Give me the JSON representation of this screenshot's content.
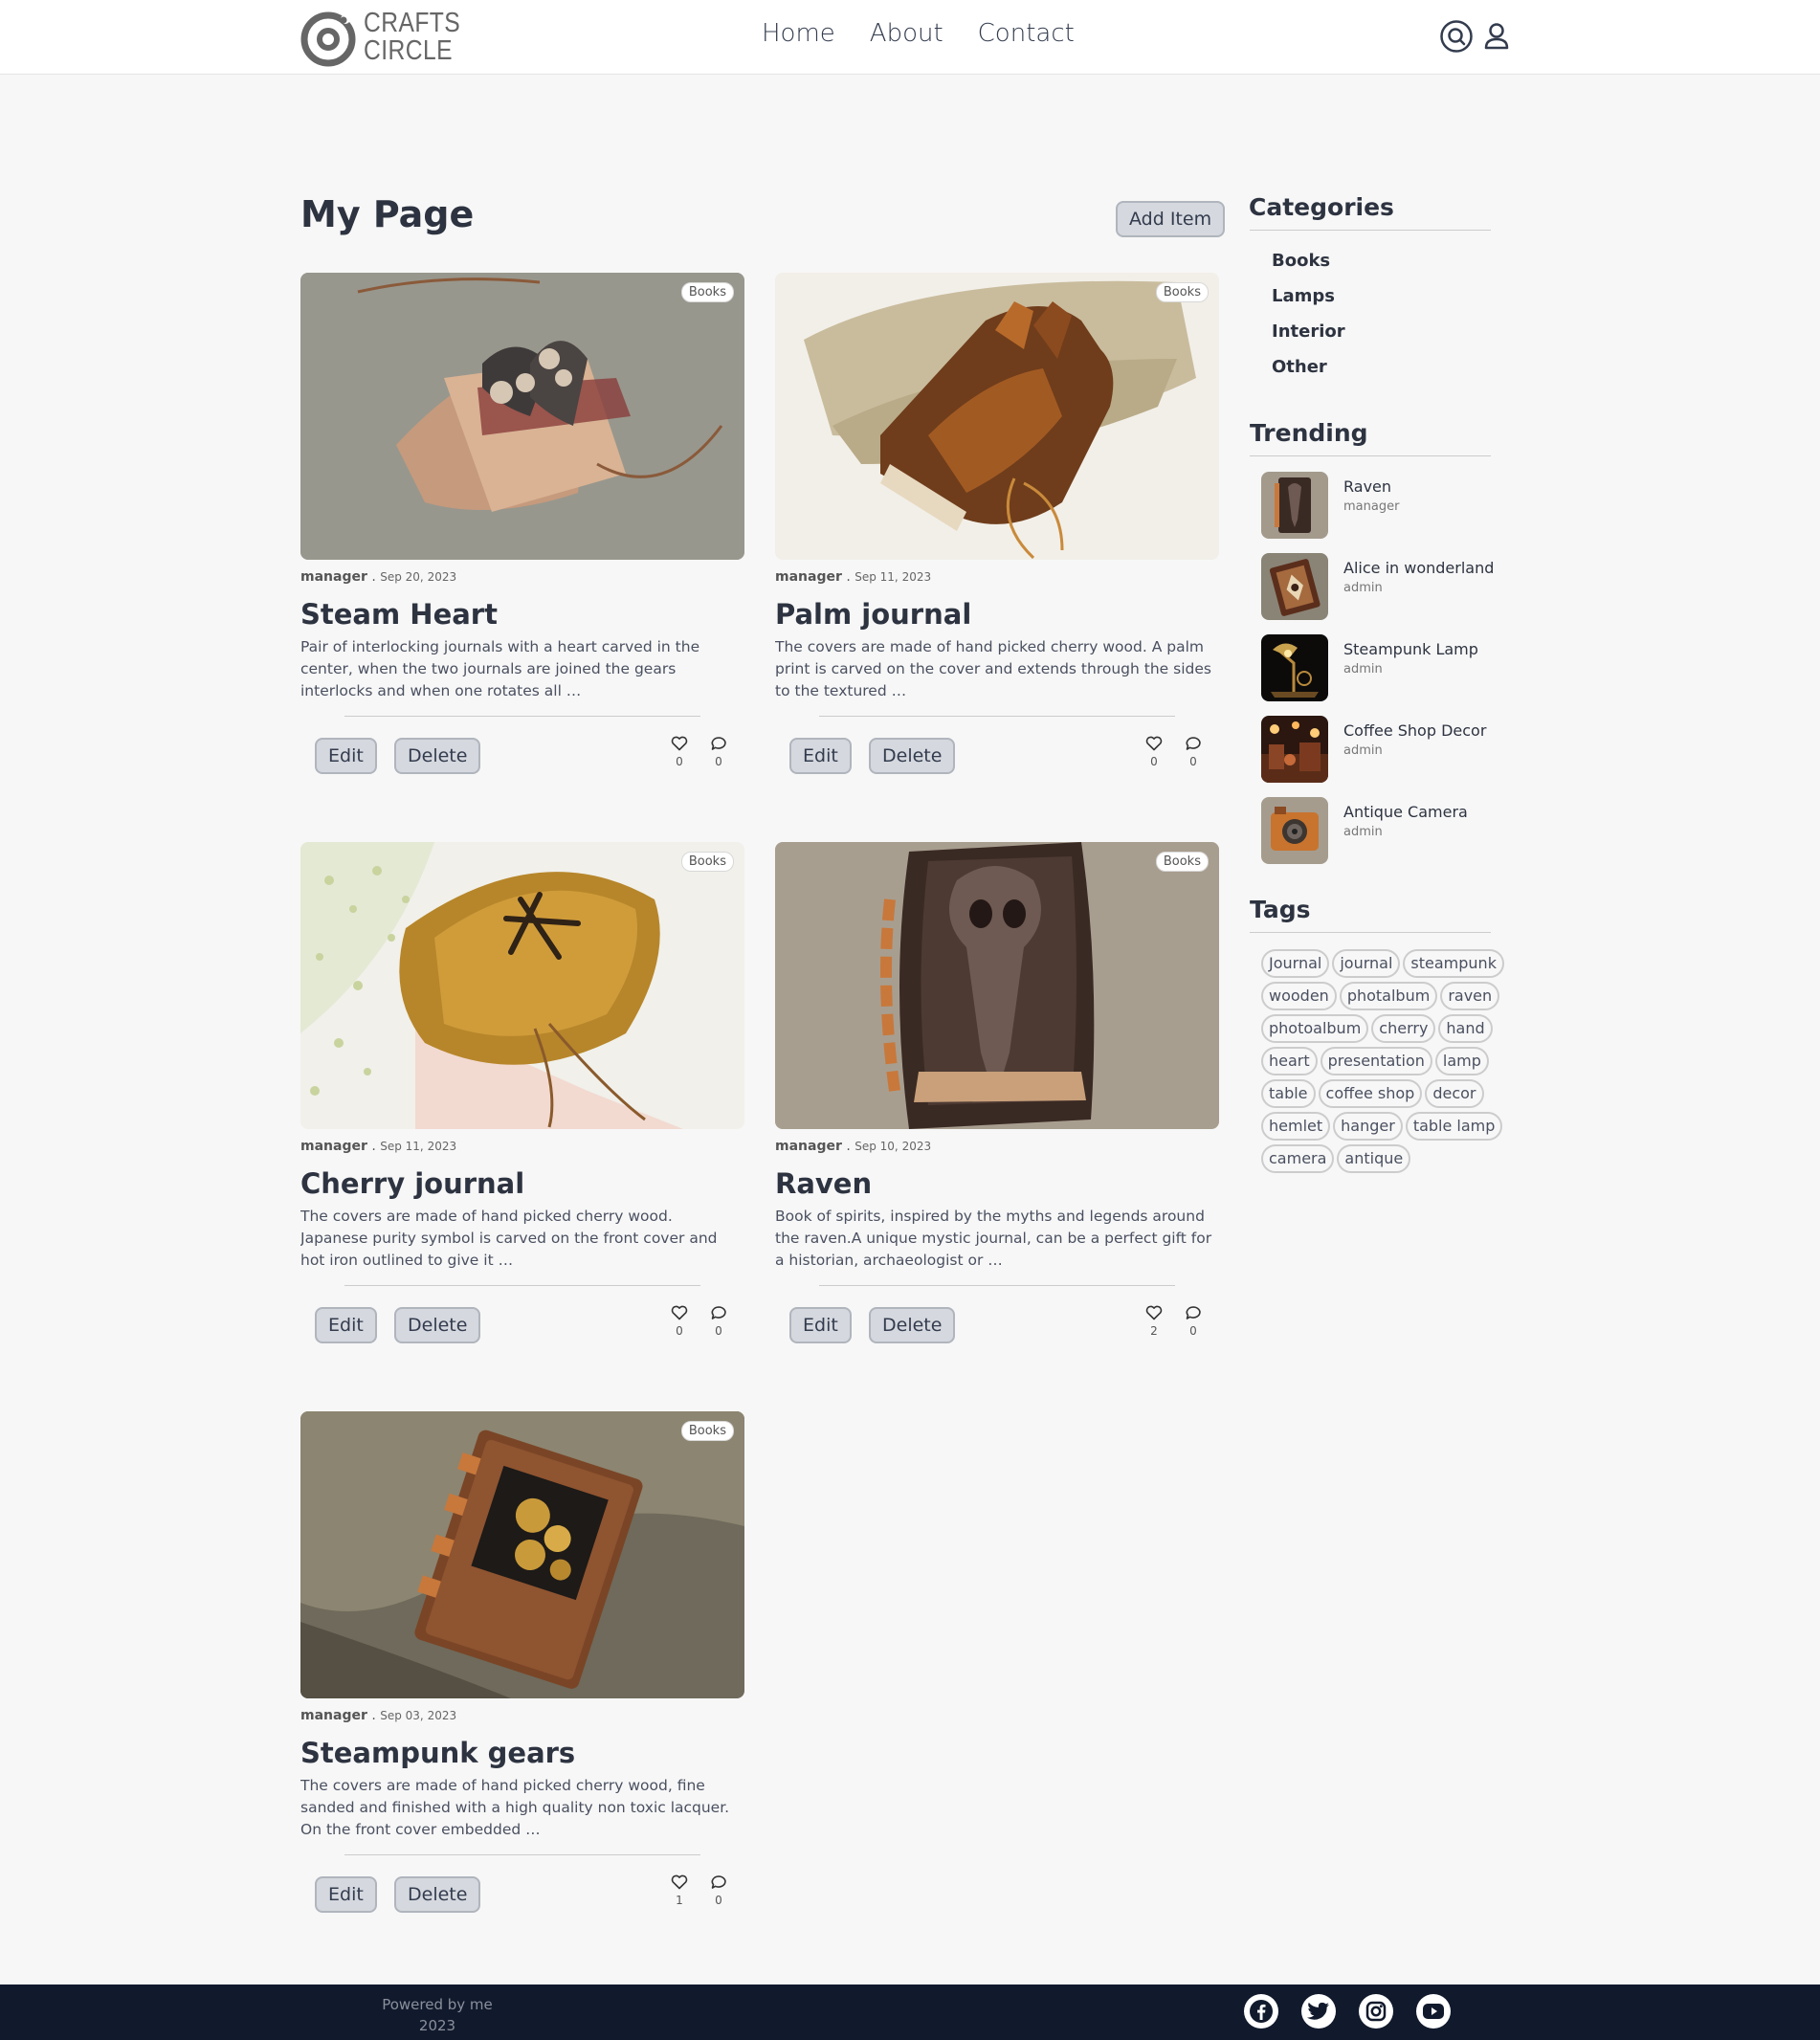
{
  "brand": {
    "line1": "CRAFTS",
    "line2": "CIRCLE"
  },
  "nav": [
    "Home",
    "About",
    "Contact"
  ],
  "page": {
    "title": "My Page",
    "add_label": "Add Item"
  },
  "cards": [
    {
      "category": "Books",
      "author": "manager",
      "date": "Sep 20, 2023",
      "title": "Steam Heart",
      "desc": "Pair of interlocking journals with a heart carved in the center, when the two journals are joined  the gears interlocks and when one rotates all …",
      "edit": "Edit",
      "delete": "Delete",
      "likes": "0",
      "comments": "0"
    },
    {
      "category": "Books",
      "author": "manager",
      "date": "Sep 11, 2023",
      "title": "Palm journal",
      "desc": "The covers are made of hand picked cherry wood. A palm print is carved on the cover and extends through the sides to the textured …",
      "edit": "Edit",
      "delete": "Delete",
      "likes": "0",
      "comments": "0"
    },
    {
      "category": "Books",
      "author": "manager",
      "date": "Sep 11, 2023",
      "title": "Cherry journal",
      "desc": "The covers are made of hand picked cherry wood. Japanese purity symbol  is carved on the front cover and hot iron outlined to give it …",
      "edit": "Edit",
      "delete": "Delete",
      "likes": "0",
      "comments": "0"
    },
    {
      "category": "Books",
      "author": "manager",
      "date": "Sep 10, 2023",
      "title": "Raven",
      "desc": "Book of spirits, inspired by the myths and legends around the raven.A unique mystic journal, can be a perfect gift for a historian, archaeologist or …",
      "edit": "Edit",
      "delete": "Delete",
      "likes": "2",
      "comments": "0"
    },
    {
      "category": "Books",
      "author": "manager",
      "date": "Sep 03, 2023",
      "title": "Steampunk gears",
      "desc": "The covers are made of hand picked cherry wood, fine sanded and finished with a high quality non toxic lacquer. On the front cover embedded …",
      "edit": "Edit",
      "delete": "Delete",
      "likes": "1",
      "comments": "0"
    }
  ],
  "sidebar": {
    "categories_title": "Categories",
    "categories": [
      "Books",
      "Lamps",
      "Interior",
      "Other"
    ],
    "trending_title": "Trending",
    "trending": [
      {
        "name": "Raven",
        "author": "manager"
      },
      {
        "name": "Alice in wonderland",
        "author": "admin"
      },
      {
        "name": "Steampunk Lamp",
        "author": "admin"
      },
      {
        "name": "Coffee Shop Decor",
        "author": "admin"
      },
      {
        "name": "Antique Camera",
        "author": "admin"
      }
    ],
    "tags_title": "Tags",
    "tags": [
      "Journal",
      "journal",
      "steampunk",
      "wooden",
      "photalbum",
      "raven",
      "photoalbum",
      "cherry",
      "hand",
      "heart",
      "presentation",
      "lamp",
      "table",
      "coffee shop",
      "decor",
      "hemlet",
      "hanger",
      "table lamp",
      "camera",
      "antique"
    ]
  },
  "footer": {
    "line1": "Powered by me",
    "line2": "2023"
  },
  "icons": {
    "search": "search-icon",
    "user": "user-icon",
    "like": "heart-icon",
    "comment": "comment-icon",
    "social": [
      "facebook-icon",
      "twitter-icon",
      "instagram-icon",
      "youtube-icon"
    ]
  },
  "colors": {
    "footer_bg": "#111a2d",
    "button_bg": "#d5d8de",
    "text": "#2d3340"
  }
}
